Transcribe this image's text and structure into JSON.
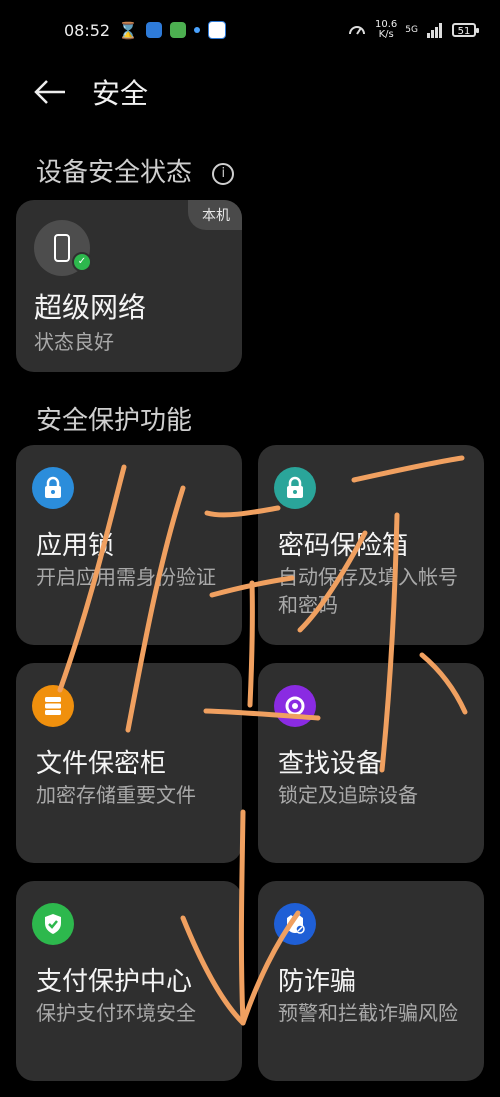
{
  "status_bar": {
    "time": "08:52",
    "net_speed_value": "10.6",
    "net_speed_unit": "K/s",
    "signal_label": "5G",
    "battery": "51"
  },
  "header": {
    "title": "安全"
  },
  "device_status": {
    "section_title": "设备安全状态",
    "card_badge": "本机",
    "card_title": "超级网络",
    "card_status": "状态良好"
  },
  "features": {
    "section_title": "安全保护功能",
    "items": [
      {
        "title": "应用锁",
        "desc": "开启应用需身份验证",
        "icon": "lock-icon",
        "color": "#2b8ddb"
      },
      {
        "title": "密码保险箱",
        "desc": "自动保存及填入帐号和密码",
        "icon": "lock-icon",
        "color": "#2aa59a"
      },
      {
        "title": "文件保密柜",
        "desc": "加密存储重要文件",
        "icon": "cabinet-icon",
        "color": "#f0900d"
      },
      {
        "title": "查找设备",
        "desc": "锁定及追踪设备",
        "icon": "target-icon",
        "color": "#8a2be2"
      },
      {
        "title": "支付保护中心",
        "desc": "保护支付环境安全",
        "icon": "shield-check-icon",
        "color": "#2db84d"
      },
      {
        "title": "防诈骗",
        "desc": "预警和拦截诈骗风险",
        "icon": "fraud-icon",
        "color": "#1f5fd6"
      }
    ]
  },
  "colors": {
    "background": "#000000",
    "card": "#2f2f2f",
    "annotation": "#f0a060"
  }
}
